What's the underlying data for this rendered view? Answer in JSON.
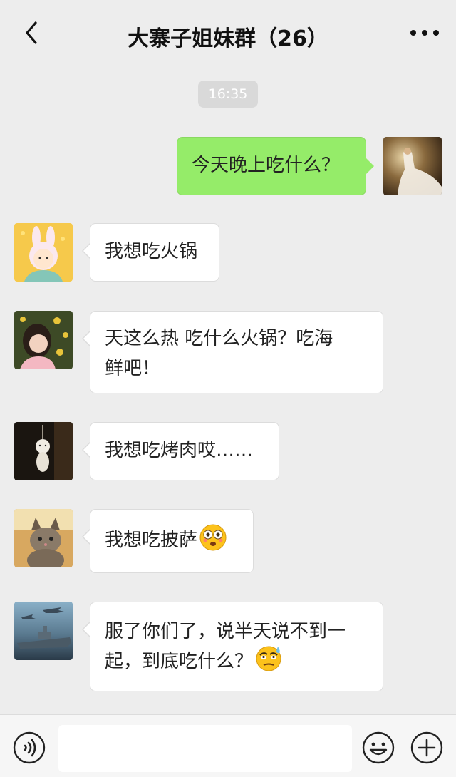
{
  "header": {
    "title": "大寨子姐妹群（26）",
    "back_icon": "chevron-left-icon",
    "more_icon": "more-dots-icon"
  },
  "timestamp": "16:35",
  "messages": [
    {
      "side": "right",
      "text": "今天晚上吃什么？",
      "avatar": "bride-photo"
    },
    {
      "side": "left",
      "text": "我想吃火锅",
      "avatar": "bunny-girl-cartoon"
    },
    {
      "side": "left",
      "text_line1": "天这么热 吃什么火锅？吃海",
      "text_line2": "鲜吧！",
      "avatar": "girl-flowers-photo"
    },
    {
      "side": "left",
      "text": "我想吃烤肉哎……",
      "avatar": "white-doll-dark-photo"
    },
    {
      "side": "left",
      "text": "我想吃披萨",
      "emoji": "astonished-face",
      "avatar": "kitten-photo"
    },
    {
      "side": "left",
      "text_line1": "服了你们了，说半天说不到一",
      "text_line2": "起，到底吃什么？",
      "emoji": "sweat-eye-roll-face",
      "avatar": "warship-aircraft-image"
    }
  ],
  "input_bar": {
    "voice_icon": "voice-icon",
    "input_value": "",
    "emoji_icon": "emoji-smile-icon",
    "plus_icon": "plus-icon"
  },
  "colors": {
    "background": "#ededed",
    "sent_bubble": "#95ec69",
    "received_bubble": "#ffffff"
  }
}
